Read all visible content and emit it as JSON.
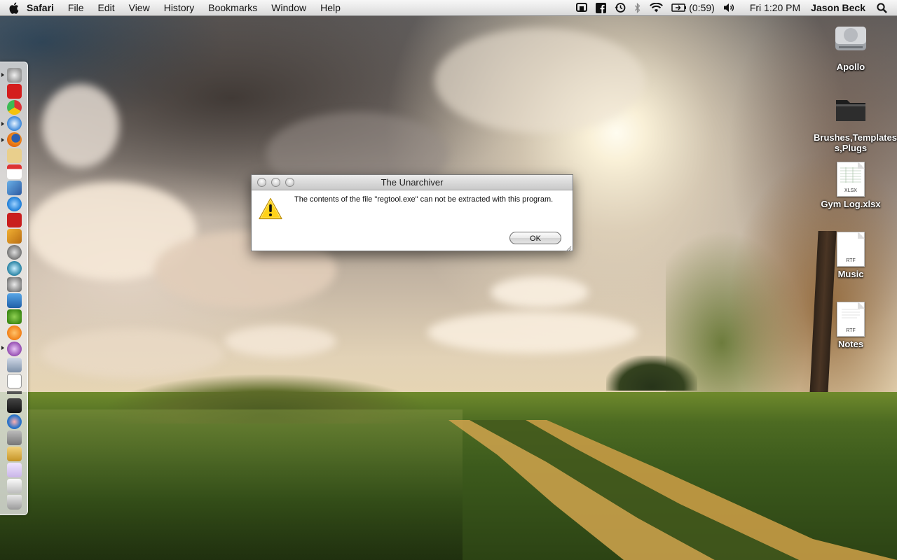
{
  "menubar": {
    "app_name": "Safari",
    "menus": [
      "File",
      "Edit",
      "View",
      "History",
      "Bookmarks",
      "Window",
      "Help"
    ],
    "battery": "(0:59)",
    "clock": "Fri 1:20 PM",
    "user": "Jason Beck"
  },
  "dialog": {
    "title": "The Unarchiver",
    "message": "The contents of the file \"regtool.exe\" can not be extracted with this program.",
    "ok_label": "OK"
  },
  "desktop": {
    "icons": [
      {
        "label": "Apollo",
        "kind": "drive"
      },
      {
        "label": "Brushes,Templates,Tuto…s,Plugs",
        "kind": "folder"
      },
      {
        "label": "Gym Log.xlsx",
        "kind": "document",
        "ext": "XLSX"
      },
      {
        "label": "Music",
        "kind": "document",
        "ext": "RTF"
      },
      {
        "label": "Notes",
        "kind": "document",
        "ext": "RTF"
      }
    ]
  },
  "dock": {
    "position": "left",
    "icons": [
      "rocket-icon",
      "acrobat-icon",
      "chrome-icon",
      "safari-icon",
      "firefox-icon",
      "mail-stamp-icon",
      "ical-icon",
      "photos-icon",
      "itunes-icon",
      "photobooth-icon",
      "iphoto-icon",
      "finalcut-icon",
      "time-machine-icon",
      "system-prefs-icon",
      "app-w-icon",
      "adium-icon",
      "pages-icon",
      "skype-like-icon",
      "calculator-icon",
      "textedit-icon",
      "dashboard-icon",
      "maps-icon",
      "trash-folder-icon",
      "stack-icon",
      "stack2-icon",
      "stack3-icon",
      "trash-icon"
    ]
  },
  "colors": {
    "menubar_bg": "#e9e9e9",
    "warning_yellow": "#ffd21a"
  }
}
